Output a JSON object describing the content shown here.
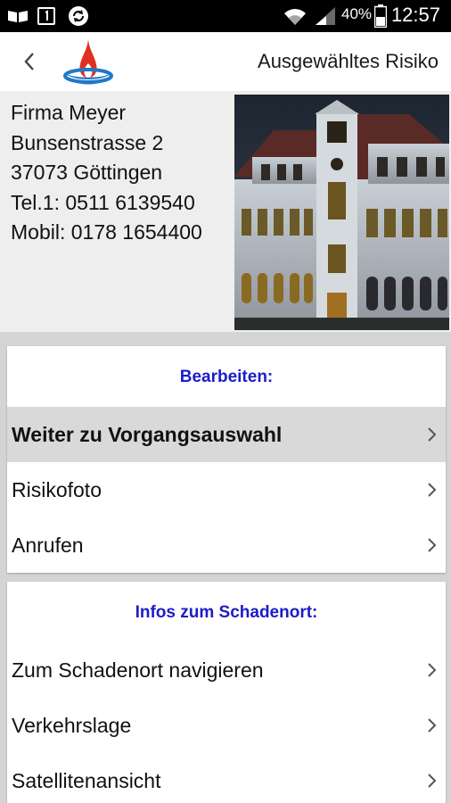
{
  "status_bar": {
    "battery": "40%",
    "time": "12:57"
  },
  "action_bar": {
    "title": "Ausgewähltes Risiko"
  },
  "contact": {
    "company": "Firma Meyer",
    "street": "Bunsenstrasse 2",
    "city": "37073 Göttingen",
    "phone": "Tel.1: 0511 6139540",
    "mobile": "Mobil: 0178 1654400"
  },
  "edit_section": {
    "heading": "Bearbeiten:",
    "items": [
      {
        "label": "Weiter zu Vorgangsauswahl"
      },
      {
        "label": "Risikofoto"
      },
      {
        "label": "Anrufen"
      }
    ]
  },
  "location_section": {
    "heading": "Infos zum Schadenort:",
    "items": [
      {
        "label": "Zum Schadenort navigieren"
      },
      {
        "label": "Verkehrslage"
      },
      {
        "label": "Satellitenansicht"
      }
    ]
  },
  "colors": {
    "heading_blue": "#1c1cc9",
    "logo_red": "#e03020",
    "logo_blue": "#1f78c8"
  }
}
